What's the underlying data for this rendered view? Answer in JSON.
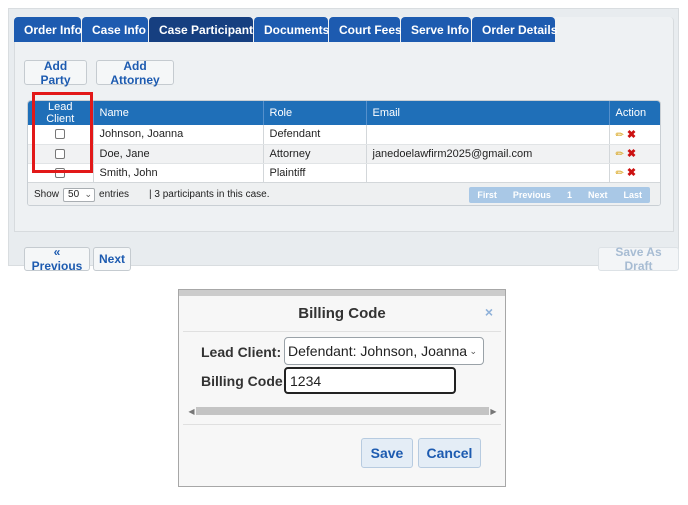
{
  "tabs": [
    {
      "label": "Order Info"
    },
    {
      "label": "Case Info"
    },
    {
      "label": "Case Participants"
    },
    {
      "label": "Documents"
    },
    {
      "label": "Court Fees"
    },
    {
      "label": "Serve Info"
    },
    {
      "label": "Order Details"
    }
  ],
  "actions": {
    "add_party": "Add Party",
    "add_attorney": "Add Attorney"
  },
  "table": {
    "headers": [
      "Lead Client",
      "Name",
      "Role",
      "Email",
      "Action"
    ],
    "rows": [
      {
        "name": "Johnson, Joanna",
        "role": "Defendant",
        "email": ""
      },
      {
        "name": "Doe, Jane",
        "role": "Attorney",
        "email": "janedoelawfirm2025@gmail.com"
      },
      {
        "name": "Smith, John",
        "role": "Plaintiff",
        "email": ""
      }
    ],
    "footer": {
      "show": "Show",
      "page_size": "50",
      "entries": "entries",
      "info": "| 3 participants in this case."
    },
    "pager": {
      "first": "First",
      "previous": "Previous",
      "current": "1",
      "next": "Next",
      "last": "Last"
    }
  },
  "nav": {
    "previous": "« Previous",
    "next": "Next",
    "save_draft": "Save As Draft"
  },
  "dialog": {
    "title": "Billing Code",
    "close": "×",
    "lead_client_label": "Lead Client:",
    "lead_client_value": "Defendant: Johnson, Joanna",
    "billing_code_label": "Billing Code:",
    "billing_code_value": "1234",
    "save": "Save",
    "cancel": "Cancel"
  },
  "colors": {
    "tab": "#1d5bb0",
    "tab_active": "#163f80",
    "header": "#1f6fb8",
    "highlight": "#e21818"
  }
}
